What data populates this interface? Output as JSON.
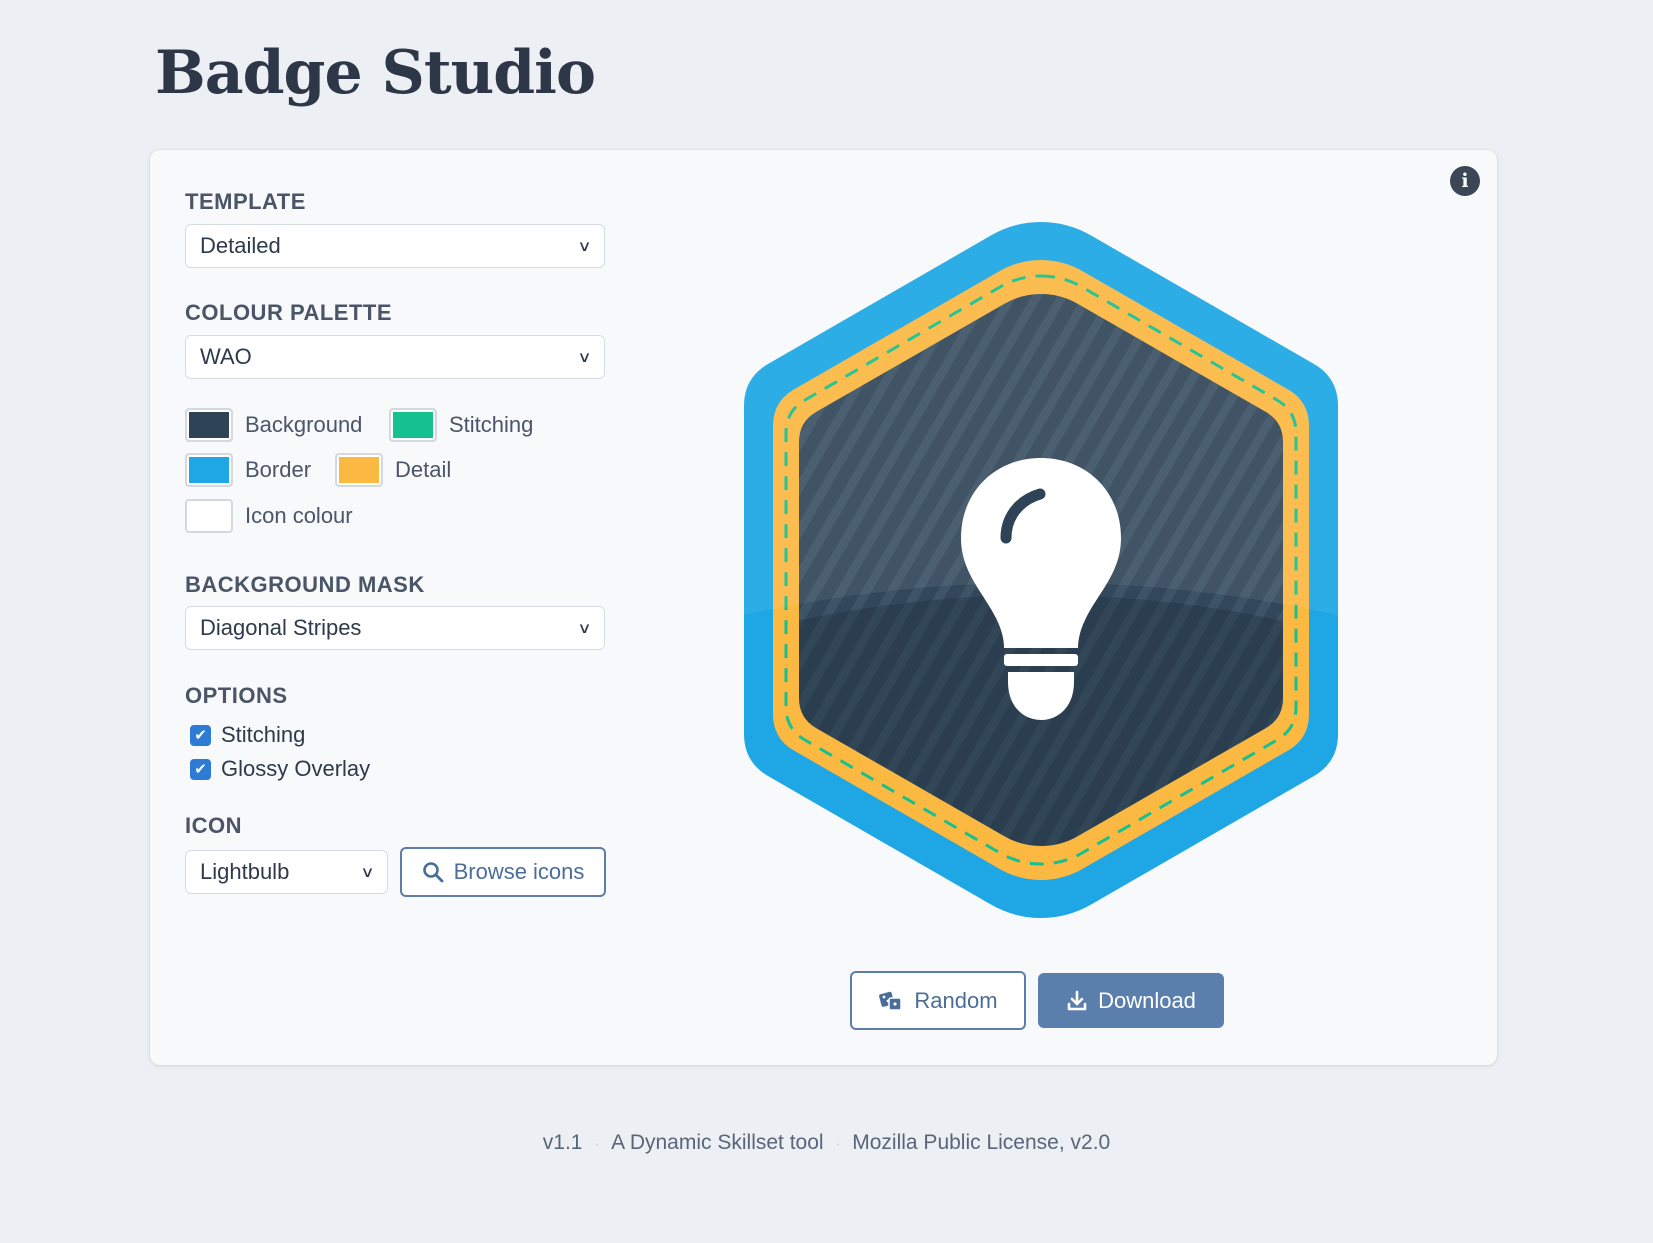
{
  "app": {
    "title": "Badge Studio"
  },
  "template": {
    "label": "TEMPLATE",
    "value": "Detailed"
  },
  "palette": {
    "label": "COLOUR PALETTE",
    "value": "WAO",
    "swatches": [
      {
        "label": "Background",
        "color": "#2f4356"
      },
      {
        "label": "Stitching",
        "color": "#16c08f"
      },
      {
        "label": "Border",
        "color": "#1ea7e4"
      },
      {
        "label": "Detail",
        "color": "#fbb942"
      },
      {
        "label": "Icon colour",
        "color": "#ffffff"
      }
    ]
  },
  "mask": {
    "label": "BACKGROUND MASK",
    "value": "Diagonal Stripes"
  },
  "options": {
    "label": "OPTIONS",
    "items": [
      {
        "label": "Stitching",
        "checked": true
      },
      {
        "label": "Glossy Overlay",
        "checked": true
      }
    ]
  },
  "icon": {
    "label": "ICON",
    "value": "Lightbulb",
    "browse_label": "Browse icons",
    "icon_name": "lightbulb-icon"
  },
  "actions": {
    "random_label": "Random",
    "download_label": "Download"
  },
  "footer": {
    "version": "v1.1",
    "tagline": "A Dynamic Skillset tool",
    "license": "Mozilla Public License, v2.0"
  }
}
